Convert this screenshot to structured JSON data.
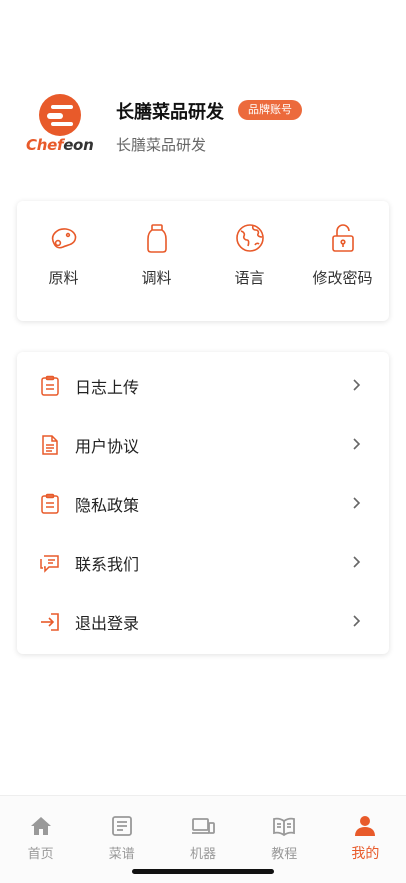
{
  "profile": {
    "logo_text_main": "Chef",
    "logo_text_accent": "eon",
    "name": "长膳菜品研发",
    "badge": "品牌账号",
    "subtitle": "长膳菜品研发"
  },
  "colors": {
    "accent": "#e85a2a",
    "badge": "#ec6a3c",
    "inactive": "#999999"
  },
  "quick_actions": [
    {
      "label": "原料",
      "icon": "meat-icon"
    },
    {
      "label": "调料",
      "icon": "seasoning-bottle-icon"
    },
    {
      "label": "语言",
      "icon": "globe-icon"
    },
    {
      "label": "修改密码",
      "icon": "lock-icon"
    }
  ],
  "menu": [
    {
      "label": "日志上传",
      "icon": "clipboard-icon"
    },
    {
      "label": "用户协议",
      "icon": "document-icon"
    },
    {
      "label": "隐私政策",
      "icon": "clipboard-icon"
    },
    {
      "label": "联系我们",
      "icon": "chat-icon"
    },
    {
      "label": "退出登录",
      "icon": "logout-icon"
    }
  ],
  "tabs": [
    {
      "label": "首页",
      "icon": "home-icon",
      "active": false
    },
    {
      "label": "菜谱",
      "icon": "recipe-icon",
      "active": false
    },
    {
      "label": "机器",
      "icon": "devices-icon",
      "active": false
    },
    {
      "label": "教程",
      "icon": "book-icon",
      "active": false
    },
    {
      "label": "我的",
      "icon": "person-icon",
      "active": true
    }
  ]
}
